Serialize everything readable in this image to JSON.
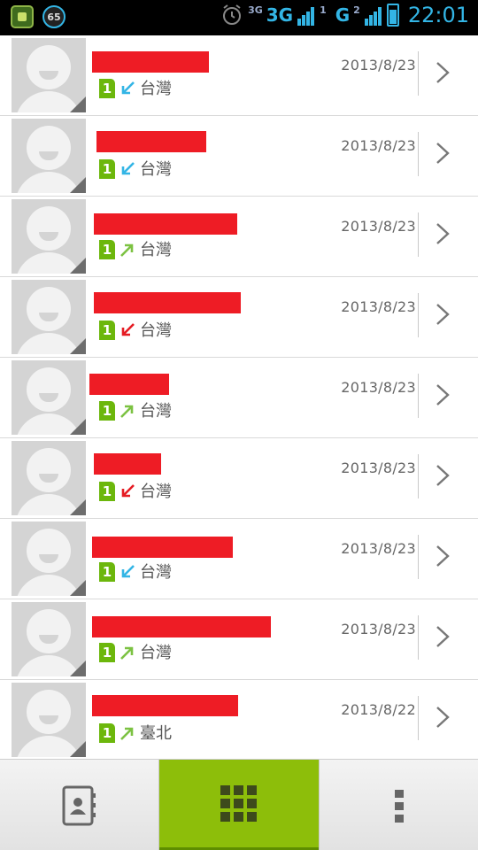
{
  "status_bar": {
    "notification_badge": "65",
    "network_small": "3G",
    "network_type": "3G",
    "sim1_label": "1",
    "network_type_2": "G",
    "sim2_label": "2",
    "time": "22:01"
  },
  "call_log": [
    {
      "date": "2013/8/23",
      "sim": "1",
      "call_type": "incoming",
      "location": "台灣"
    },
    {
      "date": "2013/8/23",
      "sim": "1",
      "call_type": "incoming",
      "location": "台灣"
    },
    {
      "date": "2013/8/23",
      "sim": "1",
      "call_type": "outgoing",
      "location": "台灣"
    },
    {
      "date": "2013/8/23",
      "sim": "1",
      "call_type": "missed",
      "location": "台灣"
    },
    {
      "date": "2013/8/23",
      "sim": "1",
      "call_type": "outgoing",
      "location": "台灣"
    },
    {
      "date": "2013/8/23",
      "sim": "1",
      "call_type": "missed",
      "location": "台灣"
    },
    {
      "date": "2013/8/23",
      "sim": "1",
      "call_type": "incoming",
      "location": "台灣"
    },
    {
      "date": "2013/8/23",
      "sim": "1",
      "call_type": "outgoing",
      "location": "台灣"
    },
    {
      "date": "2013/8/22",
      "sim": "1",
      "call_type": "outgoing",
      "location": "臺北"
    }
  ],
  "colors": {
    "incoming": "#33b5e5",
    "outgoing": "#7cc242",
    "missed": "#e51c23",
    "redaction": "#ee1c25",
    "sim_badge": "#6cb70c",
    "active_tab": "#8dbe0a"
  },
  "bottom_tabs": [
    {
      "icon": "contacts-book-icon",
      "active": false
    },
    {
      "icon": "dialpad-grid-icon",
      "active": true
    },
    {
      "icon": "overflow-menu-icon",
      "active": false
    }
  ]
}
